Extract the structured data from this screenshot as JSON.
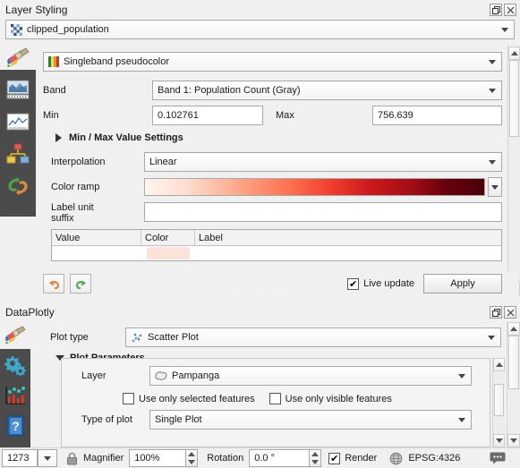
{
  "layer_styling": {
    "title": "Layer Styling",
    "float_button": "float-restore",
    "close_button": "close",
    "layer_combo": {
      "value": "clipped_population",
      "icon": "raster-layer-icon"
    },
    "rail": {
      "paintbrush": "symbology-paintbrush-icon",
      "items": [
        {
          "icon": "transparency-world-icon",
          "name": "transparency"
        },
        {
          "icon": "histogram-icon",
          "name": "histogram"
        },
        {
          "icon": "rendering-bars-icon",
          "name": "rendering"
        },
        {
          "icon": "undo-redo-history-icon",
          "name": "history"
        }
      ]
    },
    "renderer": {
      "label": "",
      "value": "Singleband pseudocolor",
      "icon": "color-ramp-icon"
    },
    "band": {
      "label": "Band",
      "value": "Band 1: Population Count (Gray)"
    },
    "min": {
      "label": "Min",
      "value": "0.102761"
    },
    "max": {
      "label": "Max",
      "value": "756.639"
    },
    "min_max_settings": {
      "label": "Min / Max Value Settings",
      "expanded": false
    },
    "interpolation": {
      "label": "Interpolation",
      "value": "Linear"
    },
    "color_ramp": {
      "label": "Color ramp",
      "name": "Reds",
      "stops": [
        "#fff5f0",
        "#fee0d2",
        "#fcbba1",
        "#fc9272",
        "#fb6a4a",
        "#ef3b2c",
        "#cb181d",
        "#a50f15",
        "#67000d",
        "#4a0008"
      ]
    },
    "label_unit_suffix": {
      "label": "Label unit\nsuffix",
      "line1": "Label unit",
      "line2": "suffix",
      "value": ""
    },
    "table": {
      "columns": [
        "Value",
        "Color",
        "Label"
      ],
      "rows": [
        {
          "value": "",
          "color": "#fbe3dc",
          "label": ""
        }
      ]
    },
    "undo_button": "undo",
    "redo_button": "redo",
    "live_update": {
      "label": "Live update",
      "checked": true
    },
    "apply_button": "Apply"
  },
  "dataplotly": {
    "title": "DataPlotly",
    "float_button": "float-restore",
    "close_button": "close",
    "rail": {
      "paintbrush": "plot-paintbrush-icon",
      "items": [
        {
          "icon": "gears-icon",
          "name": "plot-settings"
        },
        {
          "icon": "scatter-bars-icon",
          "name": "plot-view"
        },
        {
          "icon": "help-question-icon",
          "name": "help"
        }
      ]
    },
    "plot_type": {
      "label": "Plot type",
      "value": "Scatter Plot",
      "icon": "scatter-plot-icon"
    },
    "plot_parameters": {
      "label": "Plot Parameters",
      "expanded": true
    },
    "layer": {
      "label": "Layer",
      "value": "Pampanga",
      "icon": "polygon-layer-icon"
    },
    "use_only_selected": {
      "label": "Use only selected features",
      "checked": false
    },
    "use_only_visible": {
      "label": "Use only visible features",
      "checked": false
    },
    "type_of_plot": {
      "label": "Type of plot",
      "value": "Single Plot"
    }
  },
  "status_bar": {
    "scale": {
      "value": "1273"
    },
    "lock_icon": "lock-icon",
    "magnifier": {
      "label": "Magnifier",
      "value": "100%"
    },
    "rotation": {
      "label": "Rotation",
      "value": "0.0 °"
    },
    "render": {
      "label": "Render",
      "checked": true
    },
    "crs": {
      "label": "EPSG:4326",
      "icon": "globe-icon"
    },
    "messages_icon": "message-bubble-icon"
  }
}
